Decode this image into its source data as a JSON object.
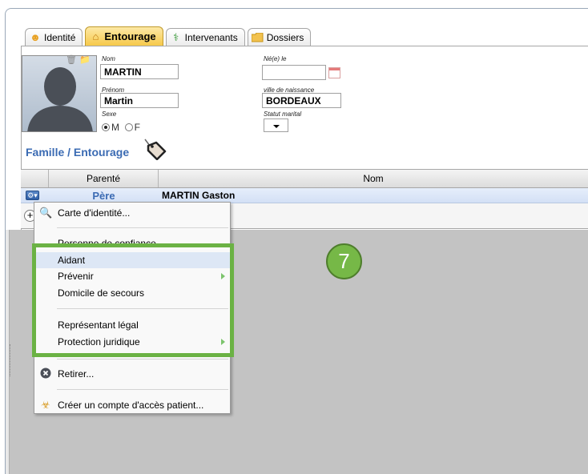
{
  "tabs": [
    {
      "label": "Identité",
      "icon": "person-icon"
    },
    {
      "label": "Entourage",
      "icon": "house-icon",
      "active": true
    },
    {
      "label": "Intervenants",
      "icon": "caduceus-icon"
    },
    {
      "label": "Dossiers",
      "icon": "folder-icon"
    }
  ],
  "form": {
    "nom_label": "Nom",
    "nom_value": "MARTIN",
    "prenom_label": "Prénom",
    "prenom_value": "Martin",
    "sexe_label": "Sexe",
    "sexe_m": "M",
    "sexe_f": "F",
    "ne_le_label": "Né(e) le",
    "ne_le_value": "",
    "ville_label": "ville de naissance",
    "ville_value": "BORDEAUX",
    "statut_label": "Statut marital"
  },
  "section_title": "Famille / Entourage",
  "grid": {
    "headers": [
      "Parenté",
      "Nom"
    ],
    "rows": [
      {
        "parente": "Père",
        "nom": "MARTIN Gaston"
      }
    ]
  },
  "context_menu": {
    "items": [
      {
        "label": "Carte d'identité...",
        "icon": "magnifier-icon"
      },
      {
        "label": "Personne de confiance",
        "icon": ""
      },
      {
        "label": "Aidant",
        "icon": "",
        "highlighted": true
      },
      {
        "label": "Prévenir",
        "icon": "",
        "submenu": true
      },
      {
        "label": "Domicile de secours",
        "icon": ""
      },
      {
        "label": "Représentant légal",
        "icon": ""
      },
      {
        "label": "Protection juridique",
        "icon": "",
        "submenu": true
      },
      {
        "label": "Retirer...",
        "icon": "remove-icon"
      },
      {
        "label": "Créer un compte d'accès patient...",
        "icon": "user-key-icon"
      }
    ]
  },
  "badge_number": "7",
  "colors": {
    "accent_blue": "#3b6bb3",
    "highlight_green": "#6bb244",
    "tab_active": "#f6c94a"
  }
}
